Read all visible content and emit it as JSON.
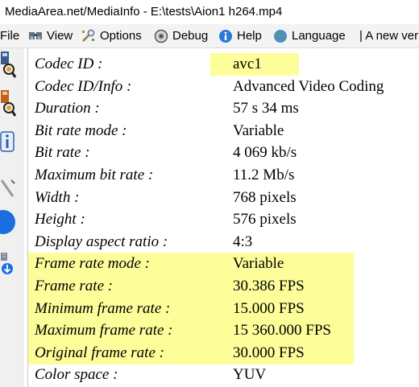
{
  "window": {
    "title": "MediaArea.net/MediaInfo - E:\\tests\\Aion1 h264.mp4"
  },
  "menu": {
    "file": "File",
    "view": "View",
    "options": "Options",
    "debug": "Debug",
    "help": "Help",
    "language": "Language",
    "new_version": "| A new ver"
  },
  "highlight_color": "#fdfd99",
  "fields": [
    {
      "label": "Codec ID :",
      "value": "avc1",
      "highlight": "value"
    },
    {
      "label": "Codec ID/Info :",
      "value": "Advanced Video Coding",
      "highlight": "none"
    },
    {
      "label": "Duration :",
      "value": "57 s 34 ms",
      "highlight": "none"
    },
    {
      "label": "Bit rate mode :",
      "value": "Variable",
      "highlight": "none"
    },
    {
      "label": "Bit rate :",
      "value": "4 069 kb/s",
      "highlight": "none"
    },
    {
      "label": "Maximum bit rate :",
      "value": "11.2 Mb/s",
      "highlight": "none"
    },
    {
      "label": "Width :",
      "value": "768 pixels",
      "highlight": "none"
    },
    {
      "label": "Height :",
      "value": "576 pixels",
      "highlight": "none"
    },
    {
      "label": "Display aspect ratio :",
      "value": "4:3",
      "highlight": "none"
    },
    {
      "label": "Frame rate mode :",
      "value": "Variable",
      "highlight": "row"
    },
    {
      "label": "Frame rate :",
      "value": "30.386 FPS",
      "highlight": "row"
    },
    {
      "label": "Minimum frame rate :",
      "value": "15.000 FPS",
      "highlight": "row"
    },
    {
      "label": "Maximum frame rate :",
      "value": "15 360.000 FPS",
      "highlight": "row"
    },
    {
      "label": "Original frame rate :",
      "value": "30.000 FPS",
      "highlight": "row"
    },
    {
      "label": "Color space :",
      "value": "YUV",
      "highlight": "none"
    }
  ]
}
